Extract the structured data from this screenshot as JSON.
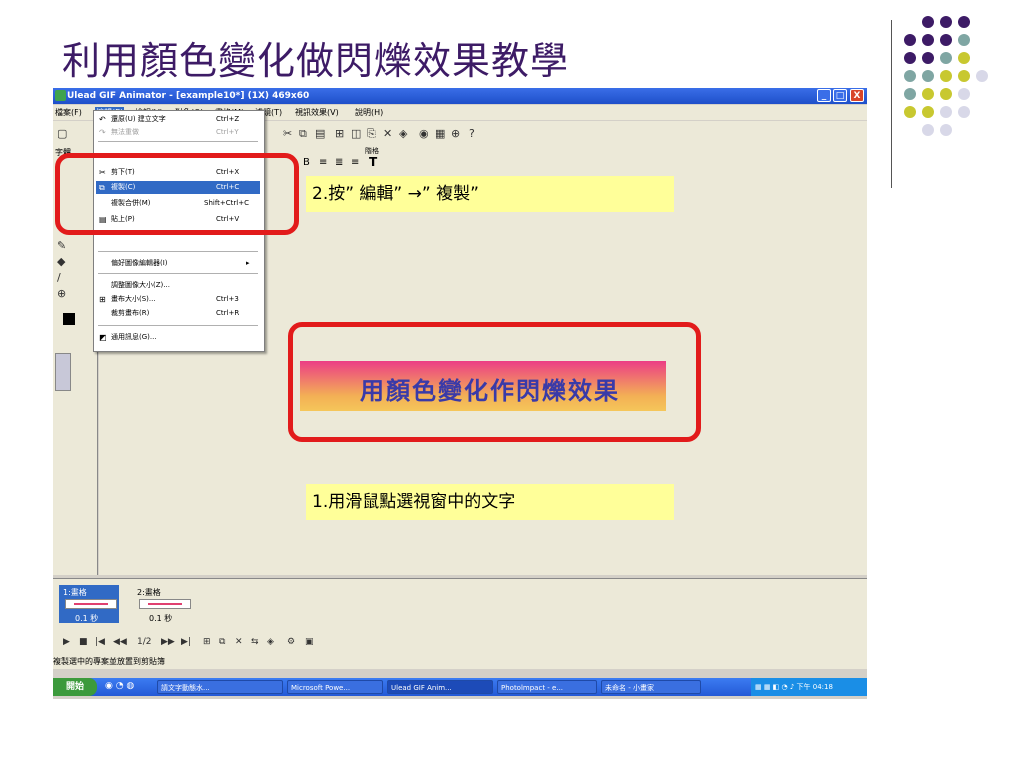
{
  "slide": {
    "title": "利用顏色變化做閃爍效果教學",
    "dot_colors": [
      "#3d1b66",
      "#7fa6a3",
      "#c8c830",
      "#d8d8e8"
    ]
  },
  "window": {
    "title": "Ulead GIF Animator - [example10*] (1X) 469x60",
    "buttons": {
      "minimize": "_",
      "maximize": "□",
      "close": "X"
    },
    "menus": [
      "檔案(F)",
      "編輯(E)",
      "檢視(V)",
      "對象(O)",
      "畫格(M)",
      "濾鏡(T)",
      "視訊效果(V)",
      "說明(H)"
    ],
    "toolbar2_labels": {
      "left": "字體",
      "right": "階格"
    }
  },
  "edit_menu": {
    "items": [
      {
        "label": "還原(U) 建立文字",
        "shortcut": "Ctrl+Z",
        "disabled": false
      },
      {
        "label": "無法重做",
        "shortcut": "Ctrl+Y",
        "disabled": true
      },
      {
        "label": "剪下(T)",
        "shortcut": "Ctrl+X",
        "disabled": false
      },
      {
        "label": "複製(C)",
        "shortcut": "Ctrl+C",
        "disabled": false,
        "highlighted": true
      },
      {
        "label": "複製合併(M)",
        "shortcut": "Shift+Ctrl+C",
        "disabled": false
      },
      {
        "label": "貼上(P)",
        "shortcut": "Ctrl+V",
        "disabled": false
      },
      {
        "label": "偏好圖像編輯器(I)",
        "shortcut": "▸",
        "disabled": false
      },
      {
        "label": "調整圖像大小(Z)...",
        "shortcut": "",
        "disabled": false
      },
      {
        "label": "畫布大小(S)...",
        "shortcut": "Ctrl+3",
        "disabled": false
      },
      {
        "label": "裁剪畫布(R)",
        "shortcut": "Ctrl+R",
        "disabled": false
      },
      {
        "label": "通用訊息(G)...",
        "shortcut": "",
        "disabled": false
      }
    ]
  },
  "callouts": {
    "step2": "2.按” 編輯” →” 複製”",
    "step1": "1.用滑鼠點選視窗中的文字"
  },
  "banner": {
    "text": "用顏色變化作閃爍效果"
  },
  "frames": [
    {
      "label": "1:畫格",
      "delay": "0.1 秒",
      "selected": true
    },
    {
      "label": "2:畫格",
      "delay": "0.1 秒",
      "selected": false
    }
  ],
  "player": {
    "position": "1/2"
  },
  "status": "複製選中的專案並放置到剪貼簿",
  "taskbar": {
    "start": "開始",
    "tasks": [
      "請文字動態水...",
      "Microsoft Powe...",
      "Ulead GIF Anim...",
      "Photolmpact - e...",
      "未命名 - 小畫家"
    ],
    "clock": "下午 04:18"
  }
}
